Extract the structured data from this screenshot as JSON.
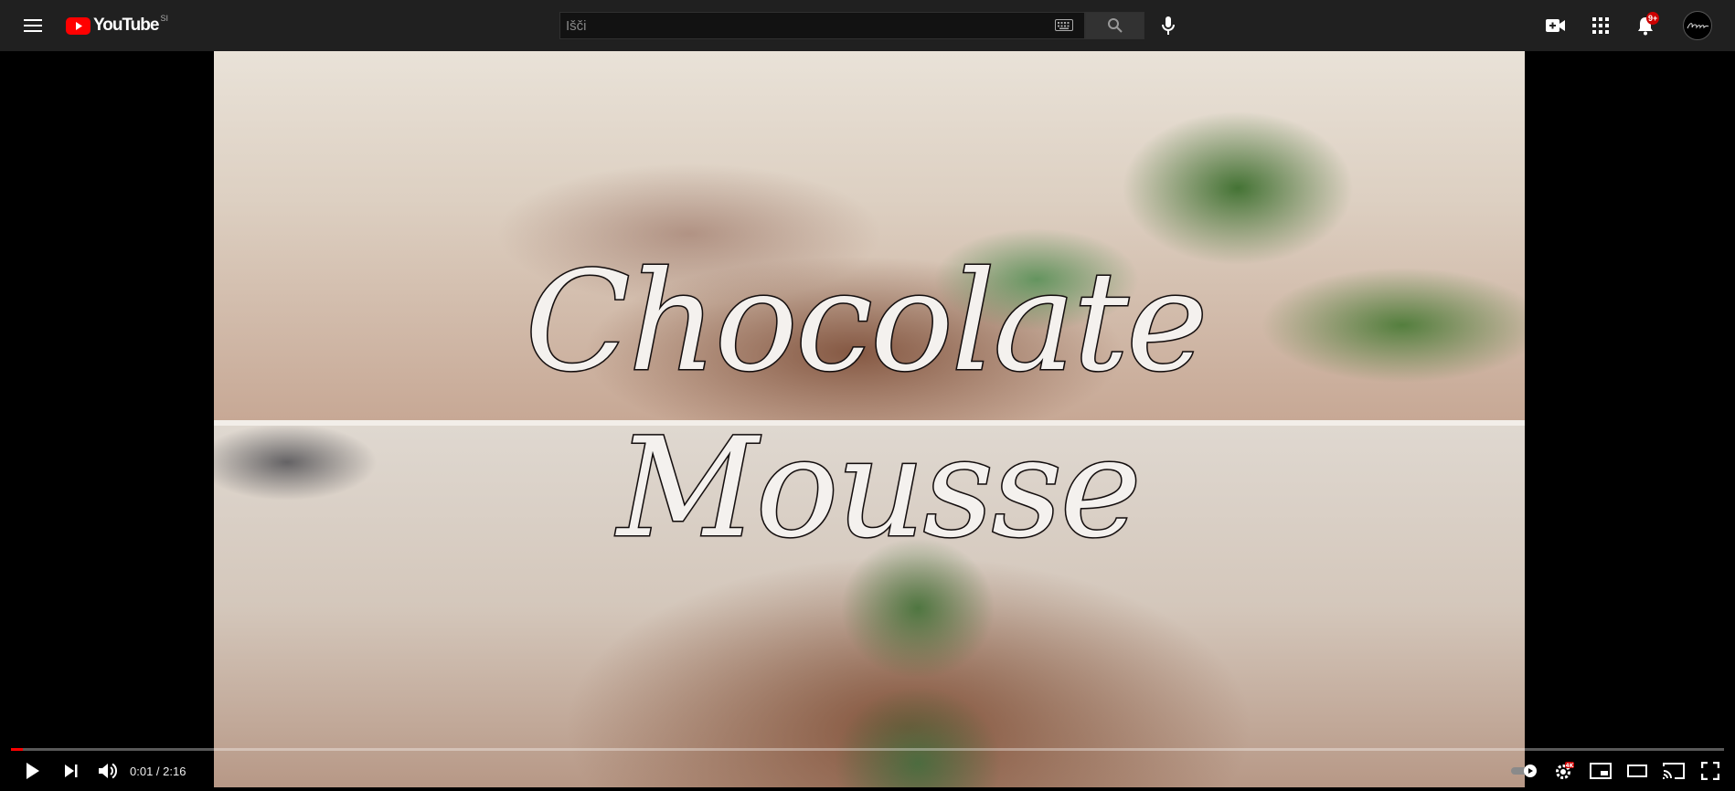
{
  "header": {
    "logo_text": "YouTube",
    "logo_region": "SI",
    "search_placeholder": "Išči",
    "notifications_badge": "9+"
  },
  "video": {
    "title_line_1": "Chocolate",
    "title_line_2": "Mousse"
  },
  "player": {
    "current_time": "0:01",
    "duration": "2:16",
    "time_display": "0:01 / 2:16",
    "progress_fraction": 0.007,
    "settings_badge": "4K"
  },
  "colors": {
    "brand_red": "#ff0000",
    "topbar_bg": "#202020"
  },
  "icons": [
    "menu-icon",
    "youtube-logo-icon",
    "keyboard-icon",
    "search-icon",
    "mic-icon",
    "create-video-icon",
    "apps-icon",
    "bell-icon",
    "avatar",
    "play-icon",
    "next-icon",
    "volume-icon",
    "autoplay-toggle-icon",
    "settings-icon",
    "miniplayer-icon",
    "theater-icon",
    "cast-icon",
    "fullscreen-icon"
  ]
}
